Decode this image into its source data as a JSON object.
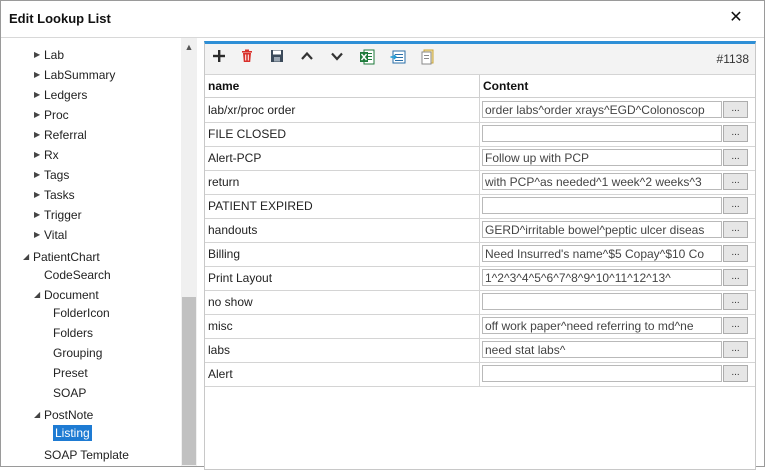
{
  "window": {
    "title": "Edit Lookup List",
    "close_glyph": "✕"
  },
  "tree": {
    "items": [
      {
        "label": "Lab",
        "arrow": "▶"
      },
      {
        "label": "LabSummary",
        "arrow": "▶"
      },
      {
        "label": "Ledgers",
        "arrow": "▶"
      },
      {
        "label": "Proc",
        "arrow": "▶"
      },
      {
        "label": "Referral",
        "arrow": "▶"
      },
      {
        "label": "Rx",
        "arrow": "▶"
      },
      {
        "label": "Tags",
        "arrow": "▶"
      },
      {
        "label": "Tasks",
        "arrow": "▶"
      },
      {
        "label": "Trigger",
        "arrow": "▶"
      },
      {
        "label": "Vital",
        "arrow": "▶"
      },
      {
        "label": "PatientChart",
        "arrow": "◢"
      },
      {
        "label": "CodeSearch",
        "arrow": ""
      },
      {
        "label": "Document",
        "arrow": "◢"
      },
      {
        "label": "FolderIcon",
        "arrow": ""
      },
      {
        "label": "Folders",
        "arrow": ""
      },
      {
        "label": "Grouping",
        "arrow": ""
      },
      {
        "label": "Preset",
        "arrow": ""
      },
      {
        "label": "SOAP",
        "arrow": ""
      },
      {
        "label": "PostNote",
        "arrow": "◢"
      },
      {
        "label": "Listing",
        "arrow": "",
        "selected": true
      },
      {
        "label": "SOAP Template",
        "arrow": ""
      }
    ],
    "scroll_up_glyph": "▲"
  },
  "toolbar": {
    "icons": [
      "add-icon",
      "delete-icon",
      "save-icon",
      "move-up-icon",
      "move-down-icon",
      "export-excel-icon",
      "import-icon",
      "notes-icon"
    ],
    "record_number": "#1138",
    "colors": {
      "add": "#2a2a2a",
      "delete": "#d9302b",
      "save": "#3b4a5a",
      "excel": "#1d7a3a",
      "import": "#2a6fa8",
      "notes": "#c9a53a"
    }
  },
  "grid": {
    "columns": {
      "name": "name",
      "content": "Content"
    },
    "rows": [
      {
        "name": "lab/xr/proc order",
        "content": "order labs^order xrays^EGD^Colonoscop"
      },
      {
        "name": "FILE CLOSED",
        "content": ""
      },
      {
        "name": "Alert-PCP",
        "content": "Follow up with PCP"
      },
      {
        "name": "return",
        "content": "with PCP^as needed^1 week^2 weeks^3"
      },
      {
        "name": "PATIENT EXPIRED",
        "content": ""
      },
      {
        "name": "handouts",
        "content": "GERD^irritable bowel^peptic ulcer diseas"
      },
      {
        "name": "Billing",
        "content": "Need Insurred's name^$5 Copay^$10 Co"
      },
      {
        "name": "Print Layout",
        "content": "1^2^3^4^5^6^7^8^9^10^11^12^13^"
      },
      {
        "name": "no show",
        "content": ""
      },
      {
        "name": "misc",
        "content": "off work paper^need referring to md^ne"
      },
      {
        "name": "labs",
        "content": "need stat labs^"
      },
      {
        "name": "Alert",
        "content": ""
      }
    ],
    "ellipsis_label": "..."
  },
  "accent_color": "#2e8fd6",
  "selection_color": "#1e7bd3"
}
